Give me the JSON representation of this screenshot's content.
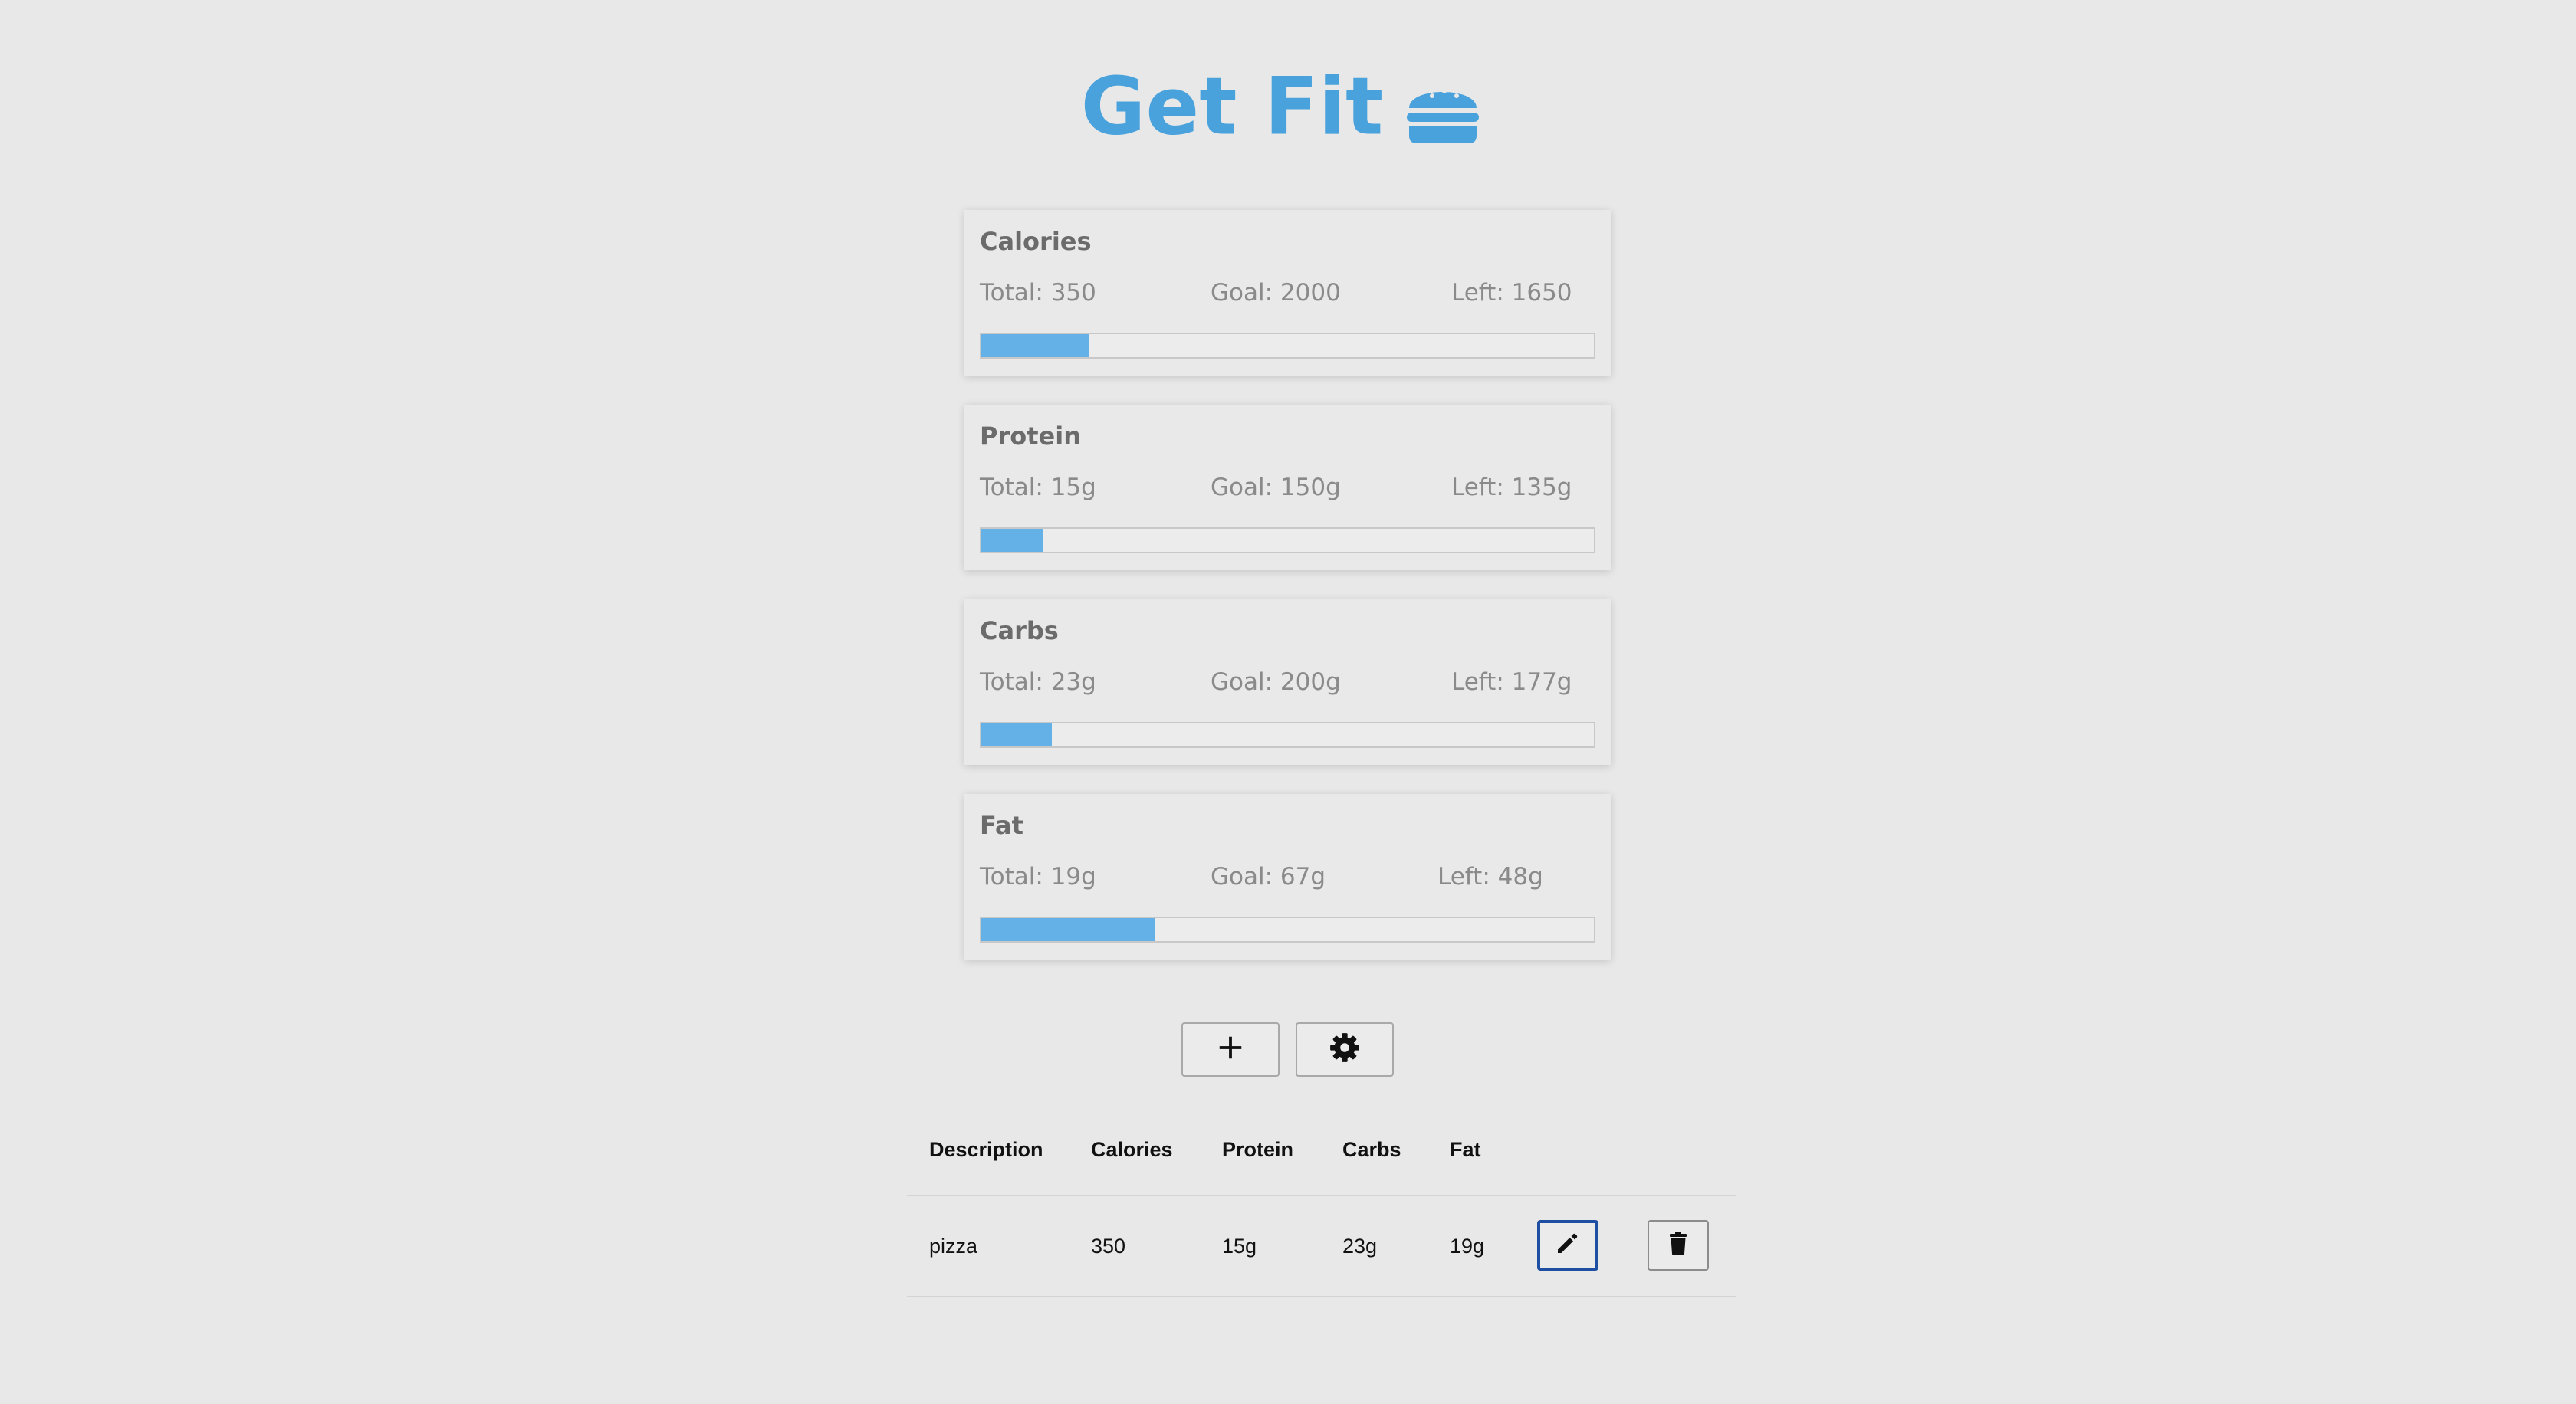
{
  "app": {
    "title": "Get Fit",
    "title_icon": "hamburger-icon",
    "accent_color": "#49a2dc",
    "progress_color": "#63b1e6"
  },
  "macros": [
    {
      "name": "Calories",
      "total": "Total: 350",
      "goal": "Goal: 2000",
      "left": "Left: 1650",
      "progress": 0.175
    },
    {
      "name": "Protein",
      "total": "Total: 15g",
      "goal": "Goal: 150g",
      "left": "Left: 135g",
      "progress": 0.1
    },
    {
      "name": "Carbs",
      "total": "Total: 23g",
      "goal": "Goal: 200g",
      "left": "Left: 177g",
      "progress": 0.115
    },
    {
      "name": "Fat",
      "total": "Total: 19g",
      "goal": "Goal: 67g",
      "left": "Left: 48g",
      "progress": 0.2836
    }
  ],
  "toolbar": {
    "add_icon": "plus-icon",
    "settings_icon": "gear-icon"
  },
  "table": {
    "headers": [
      "Description",
      "Calories",
      "Protein",
      "Carbs",
      "Fat"
    ],
    "rows": [
      {
        "description": "pizza",
        "calories": "350",
        "protein": "15g",
        "carbs": "23g",
        "fat": "19g",
        "edit_icon": "pencil-icon",
        "delete_icon": "trash-icon"
      }
    ]
  }
}
